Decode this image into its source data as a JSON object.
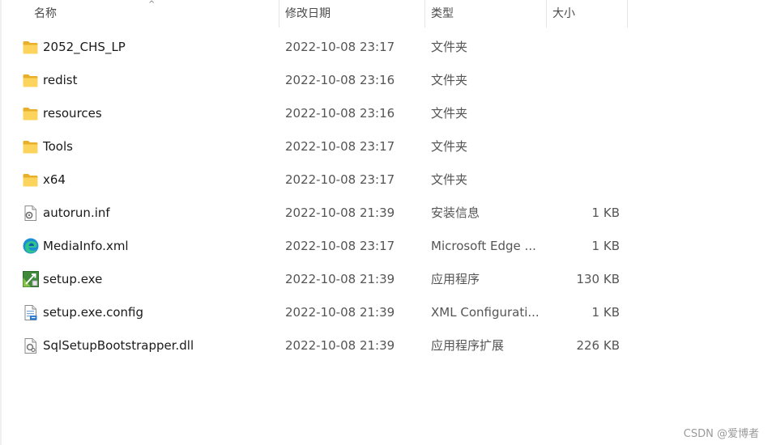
{
  "header": {
    "col_name": "名称",
    "col_date": "修改日期",
    "col_type": "类型",
    "col_size": "大小",
    "sort_glyph": "^"
  },
  "files": [
    {
      "name": "2052_CHS_LP",
      "date": "2022-10-08 23:17",
      "type": "文件夹",
      "size": "",
      "icon": "folder-icon"
    },
    {
      "name": "redist",
      "date": "2022-10-08 23:16",
      "type": "文件夹",
      "size": "",
      "icon": "folder-icon"
    },
    {
      "name": "resources",
      "date": "2022-10-08 23:16",
      "type": "文件夹",
      "size": "",
      "icon": "folder-icon"
    },
    {
      "name": "Tools",
      "date": "2022-10-08 23:17",
      "type": "文件夹",
      "size": "",
      "icon": "folder-icon"
    },
    {
      "name": "x64",
      "date": "2022-10-08 23:17",
      "type": "文件夹",
      "size": "",
      "icon": "folder-icon"
    },
    {
      "name": "autorun.inf",
      "date": "2022-10-08 21:39",
      "type": "安装信息",
      "size": "1 KB",
      "icon": "settings-file-icon"
    },
    {
      "name": "MediaInfo.xml",
      "date": "2022-10-08 23:17",
      "type": "Microsoft Edge ...",
      "size": "1 KB",
      "icon": "edge-icon"
    },
    {
      "name": "setup.exe",
      "date": "2022-10-08 21:39",
      "type": "应用程序",
      "size": "130 KB",
      "icon": "setup-exe-icon"
    },
    {
      "name": "setup.exe.config",
      "date": "2022-10-08 21:39",
      "type": "XML Configurati...",
      "size": "1 KB",
      "icon": "config-file-icon"
    },
    {
      "name": "SqlSetupBootstrapper.dll",
      "date": "2022-10-08 21:39",
      "type": "应用程序扩展",
      "size": "226 KB",
      "icon": "dll-file-icon"
    }
  ],
  "watermark": "CSDN @爱博者"
}
